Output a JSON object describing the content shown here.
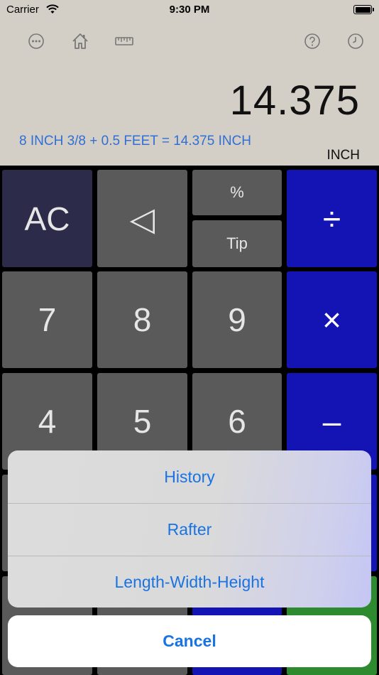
{
  "status_bar": {
    "carrier": "Carrier",
    "time": "9:30 PM"
  },
  "toolbar": {
    "icons": [
      "more-icon",
      "home-icon",
      "ruler-icon",
      "help-icon",
      "clock-icon"
    ]
  },
  "display": {
    "value": "14.375",
    "expression": "8 INCH 3/8 + 0.5 FEET = 14.375 INCH",
    "unit": "INCH"
  },
  "keypad": {
    "ac": "AC",
    "backspace": "◁",
    "percent": "%",
    "tip": "Tip",
    "divide": "÷",
    "seven": "7",
    "eight": "8",
    "nine": "9",
    "multiply": "×",
    "four": "4",
    "five": "5",
    "six": "6",
    "minus": "–"
  },
  "action_sheet": {
    "items": [
      "History",
      "Rafter",
      "Length-Width-Height"
    ],
    "cancel": "Cancel"
  },
  "colors": {
    "display_bg": "#d4cfc6",
    "key_gray": "#5a5a5a",
    "key_ac": "#2c2c4a",
    "key_operator": "#1414b4",
    "key_equals": "#2e8a2e",
    "link_blue": "#1a73e0"
  }
}
